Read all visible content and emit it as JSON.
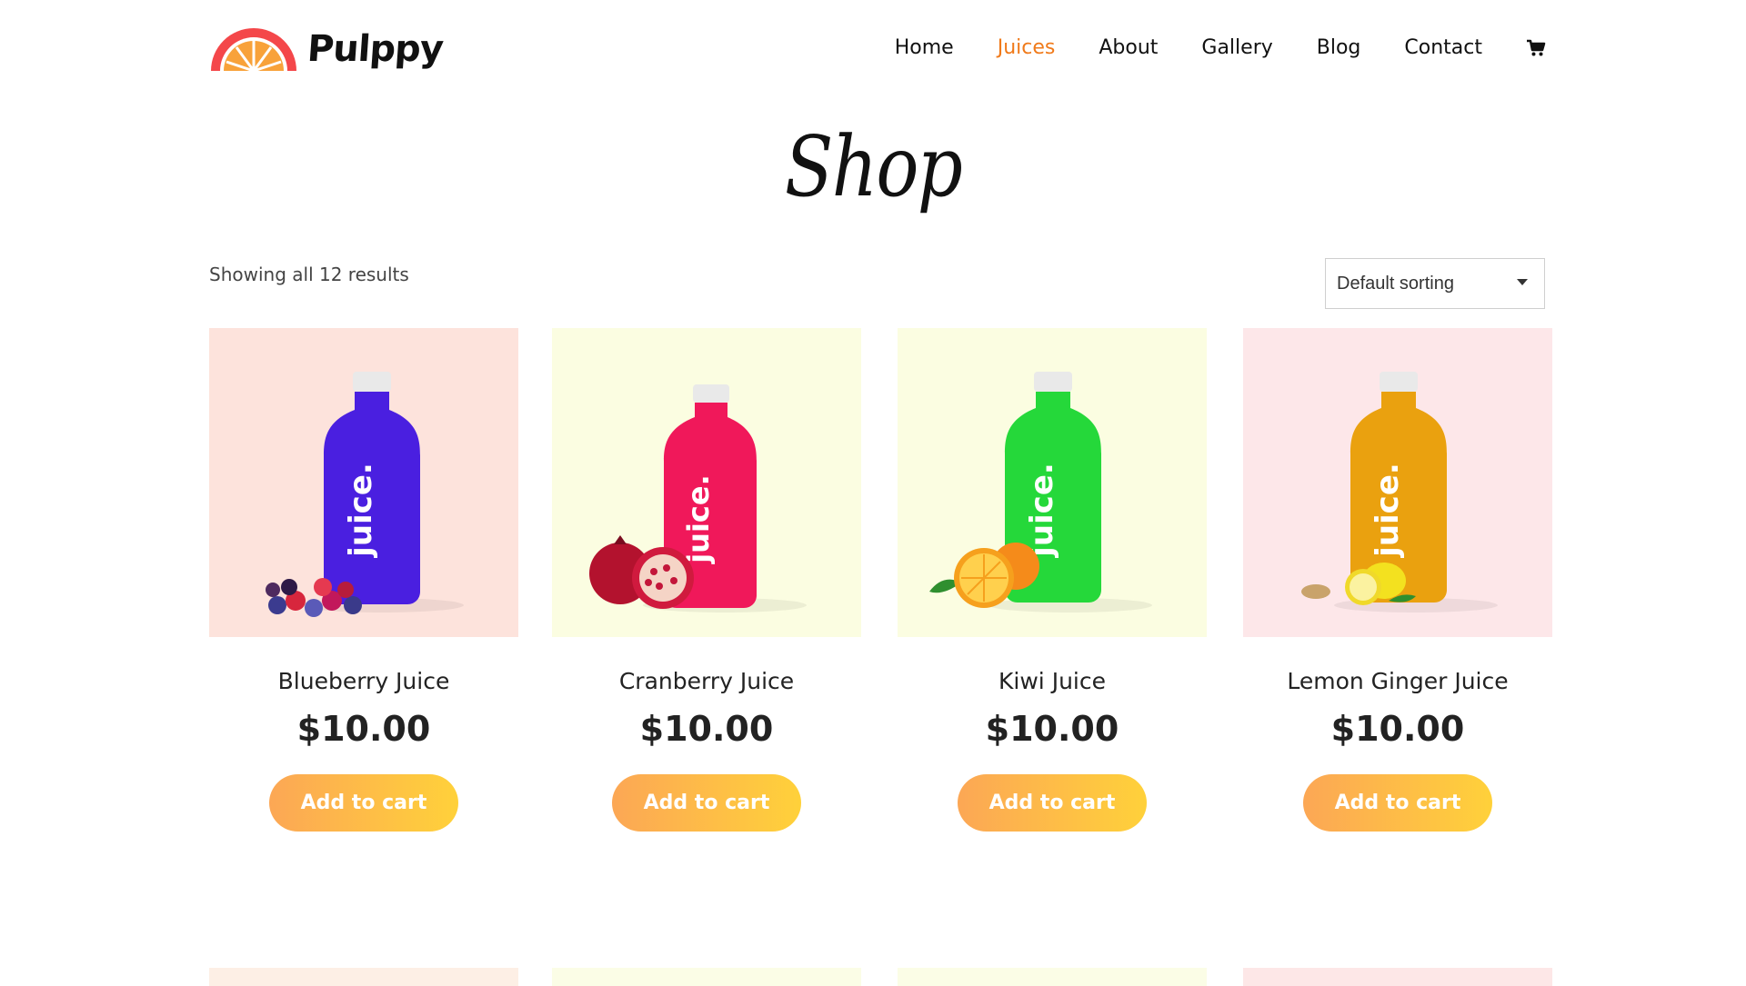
{
  "brand": {
    "name": "Pulppy"
  },
  "nav": {
    "items": [
      {
        "label": "Home",
        "active": false
      },
      {
        "label": "Juices",
        "active": true
      },
      {
        "label": "About",
        "active": false
      },
      {
        "label": "Gallery",
        "active": false
      },
      {
        "label": "Blog",
        "active": false
      },
      {
        "label": "Contact",
        "active": false
      }
    ],
    "cart_icon": "cart-icon",
    "active_color": "#f07a1a"
  },
  "page": {
    "title": "Shop"
  },
  "listing": {
    "results_text": "Showing all 12 results",
    "sort_selected": "Default sorting"
  },
  "products": [
    {
      "name": "Blueberry Juice",
      "price": "$10.00",
      "button": "Add to cart",
      "bg": "#fde3dc",
      "bottle": "#4a1fe0",
      "label": "juice."
    },
    {
      "name": "Cranberry Juice",
      "price": "$10.00",
      "button": "Add to cart",
      "bg": "#fbfde1",
      "bottle": "#f0185a",
      "label": "juice."
    },
    {
      "name": "Kiwi Juice",
      "price": "$10.00",
      "button": "Add to cart",
      "bg": "#fbfde1",
      "bottle": "#25d83a",
      "label": "juice."
    },
    {
      "name": "Lemon Ginger Juice",
      "price": "$10.00",
      "button": "Add to cart",
      "bg": "#fde7e9",
      "bottle": "#eaa10f",
      "label": "juice."
    }
  ],
  "bottom_row_colors": [
    "#fdefe5",
    "#fbfde6",
    "#fbfde6",
    "#fde7e7"
  ],
  "colors": {
    "button_gradient_start": "#fca755",
    "button_gradient_end": "#ffd13a"
  }
}
